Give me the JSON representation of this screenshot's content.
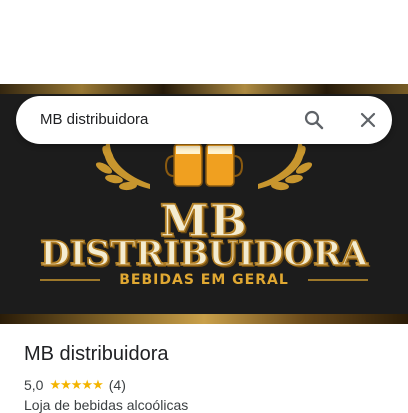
{
  "search": {
    "query": "MB distribuidora"
  },
  "hero": {
    "logo_line1": "MB",
    "logo_line2": "DISTRIBUIDORA",
    "logo_line3": "BEBIDAS EM GERAL"
  },
  "place": {
    "name": "MB distribuidora",
    "rating": "5,0",
    "stars": "★★★★★",
    "review_count": "(4)",
    "category": "Loja de bebidas alcoólicas"
  },
  "colors": {
    "star": "#f4b400",
    "logo_gold": "#b07d24",
    "logo_cream": "#f4ecd0",
    "hero_bg": "#1c1c1c"
  },
  "icons": [
    "search-icon",
    "close-icon",
    "beer-mugs-icon",
    "wheat-icon"
  ]
}
